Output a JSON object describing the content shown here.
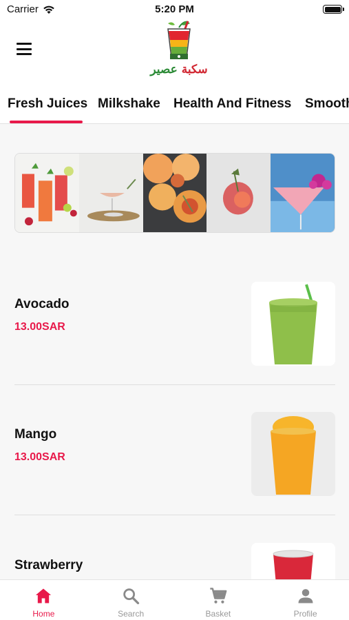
{
  "status_bar": {
    "carrier": "Carrier",
    "time": "5:20 PM"
  },
  "header": {
    "logo_word_1": "سكبة",
    "logo_word_2": "عصير"
  },
  "tabs": [
    {
      "label": "Fresh Juices",
      "active": true
    },
    {
      "label": "Milkshake",
      "active": false
    },
    {
      "label": "Health And Fitness",
      "active": false
    },
    {
      "label": "Smoothies",
      "active": false
    }
  ],
  "products": [
    {
      "name": "Avocado",
      "price": "13.00SAR",
      "drink_color": "#8fbf4a"
    },
    {
      "name": "Mango",
      "price": "13.00SAR",
      "drink_color": "#f5a623"
    },
    {
      "name": "Strawberry",
      "price": "",
      "drink_color": "#d9283a"
    }
  ],
  "bottom_nav": [
    {
      "label": "Home",
      "icon": "home-icon",
      "active": true
    },
    {
      "label": "Search",
      "icon": "search-icon",
      "active": false
    },
    {
      "label": "Basket",
      "icon": "cart-icon",
      "active": false
    },
    {
      "label": "Profile",
      "icon": "user-icon",
      "active": false
    }
  ],
  "colors": {
    "accent": "#e8194a",
    "background": "#f7f7f7"
  }
}
